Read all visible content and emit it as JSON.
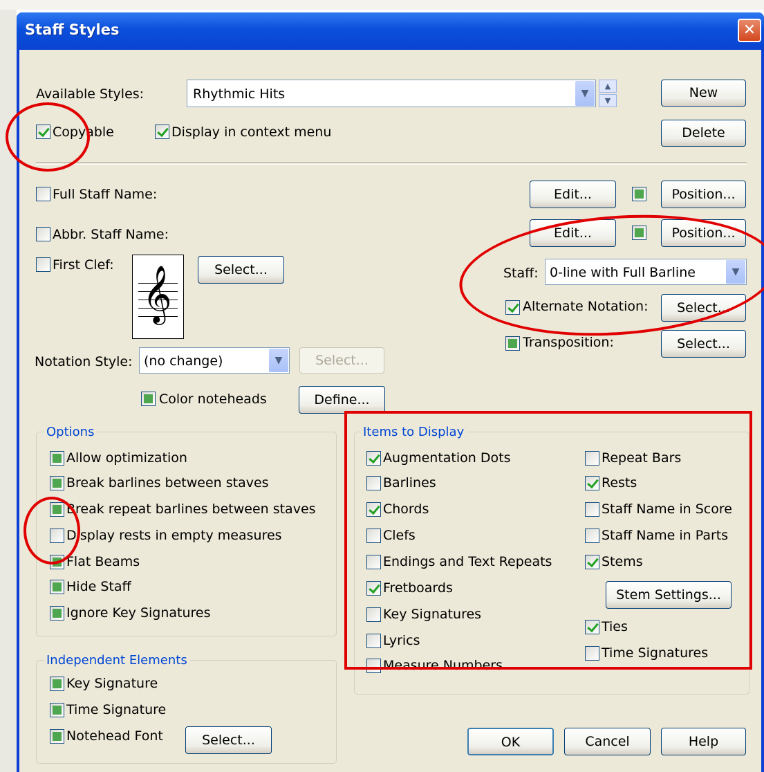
{
  "window": {
    "title": "Staff Styles",
    "close_glyph": "✕"
  },
  "available_styles": {
    "label": "Available Styles:",
    "value": "Rhythmic Hits"
  },
  "buttons": {
    "new": "New",
    "delete": "Delete",
    "edit": "Edit...",
    "position": "Position...",
    "select": "Select...",
    "define": "Define...",
    "stem_settings": "Stem Settings...",
    "ok": "OK",
    "cancel": "Cancel",
    "help": "Help"
  },
  "copyable": {
    "label": "Copyable",
    "checked": true
  },
  "display_in_context_menu": {
    "label": "Display in context menu",
    "checked": true
  },
  "full_staff_name": {
    "label": "Full Staff Name:"
  },
  "abbr_staff_name": {
    "label": "Abbr. Staff Name:"
  },
  "first_clef": {
    "label": "First Clef:",
    "clef_glyph": "𝄞"
  },
  "staff": {
    "label": "Staff:",
    "value": "0-line with Full Barline"
  },
  "alternate_notation": {
    "label": "Alternate Notation:",
    "checked": true
  },
  "transposition": {
    "label": "Transposition:"
  },
  "notation_style": {
    "label": "Notation Style:",
    "value": "(no change)"
  },
  "color_noteheads": {
    "label": "Color noteheads"
  },
  "options": {
    "title": "Options",
    "items": [
      {
        "label": "Allow optimization",
        "state": "mixed"
      },
      {
        "label": "Break barlines between staves",
        "state": "mixed"
      },
      {
        "label": "Break repeat barlines between staves",
        "state": "mixed"
      },
      {
        "label": "Display rests in empty measures",
        "state": "unchecked"
      },
      {
        "label": "Flat Beams",
        "state": "mixed"
      },
      {
        "label": "Hide Staff",
        "state": "mixed"
      },
      {
        "label": "Ignore Key Signatures",
        "state": "mixed"
      }
    ]
  },
  "independent_elements": {
    "title": "Independent Elements",
    "items": [
      {
        "label": "Key Signature",
        "state": "mixed"
      },
      {
        "label": "Time Signature",
        "state": "mixed"
      },
      {
        "label": "Notehead Font",
        "state": "mixed"
      }
    ]
  },
  "items_to_display": {
    "title": "Items to Display",
    "left": [
      {
        "label": "Augmentation Dots",
        "state": "checked"
      },
      {
        "label": "Barlines",
        "state": "unchecked"
      },
      {
        "label": "Chords",
        "state": "checked"
      },
      {
        "label": "Clefs",
        "state": "unchecked"
      },
      {
        "label": "Endings and Text Repeats",
        "state": "unchecked"
      },
      {
        "label": "Fretboards",
        "state": "checked"
      },
      {
        "label": "Key Signatures",
        "state": "unchecked"
      },
      {
        "label": "Lyrics",
        "state": "unchecked"
      },
      {
        "label": "Measure Numbers",
        "state": "unchecked"
      }
    ],
    "right": [
      {
        "label": "Repeat Bars",
        "state": "unchecked"
      },
      {
        "label": "Rests",
        "state": "checked"
      },
      {
        "label": "Staff Name in Score",
        "state": "unchecked"
      },
      {
        "label": "Staff Name in Parts",
        "state": "unchecked"
      },
      {
        "label": "Stems",
        "state": "checked"
      },
      {
        "label": "Ties",
        "state": "checked"
      },
      {
        "label": "Time Signatures",
        "state": "unchecked"
      }
    ]
  },
  "colors": {
    "titlebar": "#0a4fdc",
    "dialog_bg": "#ece9d8",
    "group_label": "#0046d5",
    "annotation": "#e00000"
  },
  "icons": {
    "combo_arrow": "▼",
    "spin_up": "▲",
    "spin_down": "▼"
  }
}
